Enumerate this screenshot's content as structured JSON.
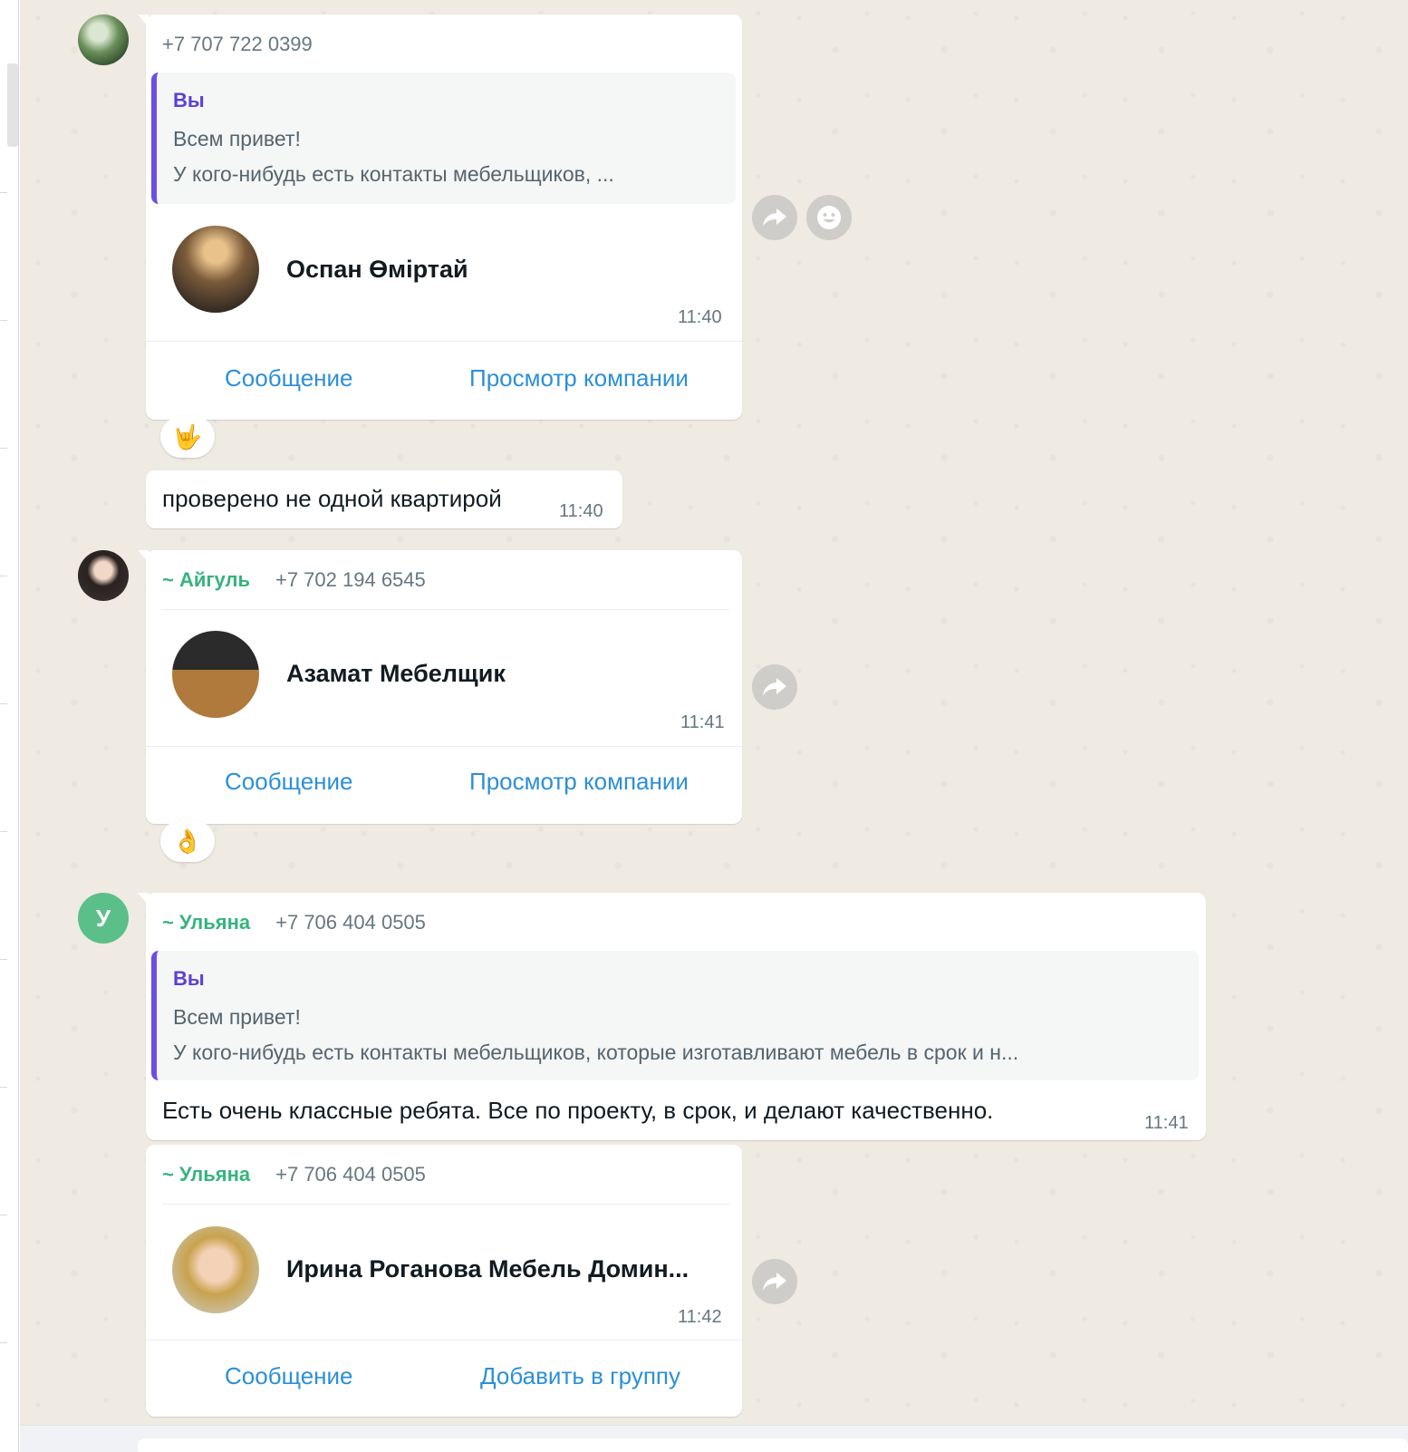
{
  "messages": [
    {
      "phone": "+7 707 722 0399",
      "quote": {
        "author": "Вы",
        "line1": "Всем привет!",
        "line2": "У кого-нибудь есть контакты  мебельщиков, ..."
      },
      "contact_name": "Оспан Өміртай",
      "time": "11:40",
      "action_left": "Сообщение",
      "action_right": "Просмотр компании",
      "reaction": "🤟"
    },
    {
      "text": "проверено не одной квартирой",
      "time": "11:40"
    },
    {
      "sender": "~ Айгуль",
      "phone": "+7 702 194 6545",
      "contact_name": "Азамат Мебелщик",
      "time": "11:41",
      "action_left": "Сообщение",
      "action_right": "Просмотр компании",
      "reaction": "👌"
    },
    {
      "avatar_letter": "У",
      "sender": "~ Ульяна",
      "phone": "+7 706 404 0505",
      "quote": {
        "author": "Вы",
        "line1": "Всем привет!",
        "line2": "У кого-нибудь есть контакты  мебельщиков, которые  изготавливают мебель в срок и н..."
      },
      "text": "Есть очень классные ребята. Все по проекту, в срок, и делают качественно.",
      "time": "11:41"
    },
    {
      "sender": "~ Ульяна",
      "phone": "+7 706 404 0505",
      "contact_name": "Ирина Роганова Мебель Домин...",
      "time": "11:42",
      "action_left": "Сообщение",
      "action_right": "Добавить в группу"
    }
  ],
  "icons": {
    "forward": "forward-icon",
    "emoji": "emoji-icon"
  },
  "colors": {
    "chat_background": "#efeae2",
    "sender_name": "#36b37e",
    "quote_author": "#5c3fd6",
    "quote_bar": "#6b4ee6",
    "action_link": "#2c8fd8"
  }
}
